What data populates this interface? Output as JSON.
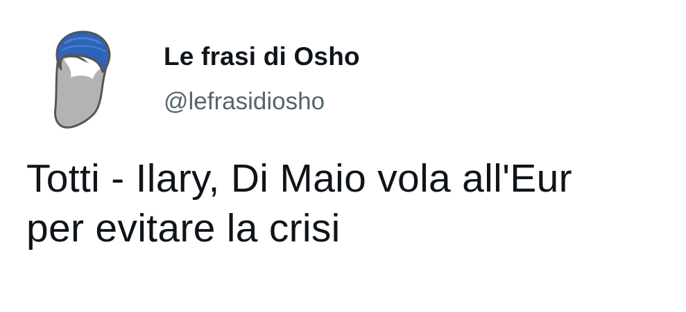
{
  "tweet": {
    "author": {
      "display_name": "Le frasi di Osho",
      "handle": "@lefrasidiosho",
      "avatar_icon": "bearded-face-avatar-icon"
    },
    "text_lines": [
      "Totti - Ilary, Di Maio vola all'Eur",
      "per evitare la crisi"
    ]
  },
  "colors": {
    "text_primary": "#0f1419",
    "text_secondary": "#536471",
    "avatar_cap": "#2f63b8",
    "avatar_beard": "#b3b3b3",
    "avatar_outline": "#555555",
    "background": "#ffffff"
  }
}
